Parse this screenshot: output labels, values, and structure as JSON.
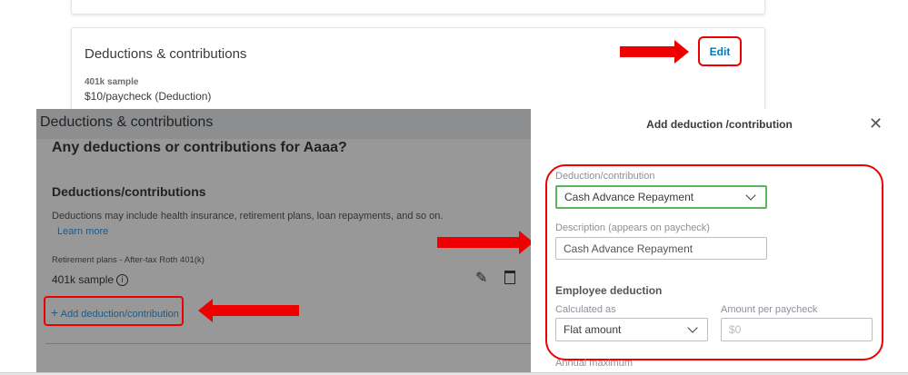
{
  "card": {
    "title": "Deductions & contributions",
    "item_type": "401k sample",
    "item_detail": "$10/paycheck (Deduction)",
    "edit_label": "Edit"
  },
  "overlay": {
    "header": "Deductions & contributions",
    "question": "Any deductions or contributions for Aaaa?",
    "section_title": "Deductions/contributions",
    "description": "Deductions may include health insurance, retirement plans, loan repayments, and so on.",
    "learn_more": "Learn more",
    "item_category": "Retirement plans - After-tax Roth 401(k)",
    "item_name": "401k sample",
    "add_label": "Add deduction/contribution"
  },
  "panel": {
    "title": "Add deduction /contribution",
    "deduction_label": "Deduction/contribution",
    "deduction_value": "Cash Advance Repayment",
    "description_label": "Description (appears on paycheck)",
    "description_value": "Cash Advance Repayment",
    "employee_section": "Employee deduction",
    "calculated_label": "Calculated as",
    "calculated_value": "Flat amount",
    "amount_label": "Amount per paycheck",
    "amount_placeholder": "$0",
    "annual_max_label": "Annual maximum"
  },
  "colors": {
    "annotation": "#e00000",
    "link": "#0077c5",
    "focus": "#5bb55b"
  }
}
